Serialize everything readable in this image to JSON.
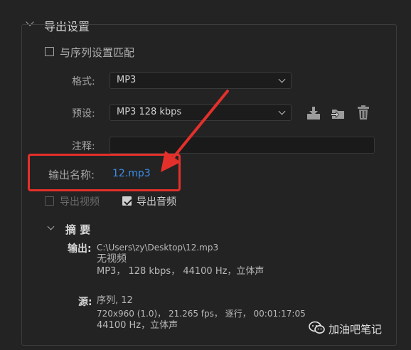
{
  "export_settings": {
    "title": "导出设置",
    "match_sequence_label": "与序列设置匹配",
    "match_sequence_checked": false,
    "format": {
      "label": "格式:",
      "value": "MP3"
    },
    "preset": {
      "label": "预设:",
      "value": "MP3 128 kbps"
    },
    "comment": {
      "label": "注释:",
      "value": ""
    },
    "output_name": {
      "label": "输出名称:",
      "value": "12.mp3"
    },
    "export_video": {
      "label": "导出视频",
      "checked": false,
      "enabled": false
    },
    "export_audio": {
      "label": "导出音频",
      "checked": true,
      "enabled": true
    },
    "icons": [
      "save-preset-icon",
      "import-preset-icon",
      "delete-preset-icon"
    ]
  },
  "summary": {
    "title": "摘 要",
    "output": {
      "label": "输出:",
      "path": "C:\\Users\\zy\\Desktop\\12.mp3",
      "line2": "无视频",
      "line3": "MP3， 128 kbps， 44100 Hz，立体声"
    },
    "source": {
      "label": "源:",
      "line1": "序列, 12",
      "line2": "720x960 (1.0)， 21.265 fps， 逐行， 00:01:17:05",
      "line3": "44100 Hz，立体声"
    }
  },
  "watermark": {
    "text": "加油吧笔记"
  },
  "colors": {
    "accent_link": "#3b8ee8",
    "annotation": "#e4302b",
    "background": "#232323"
  }
}
